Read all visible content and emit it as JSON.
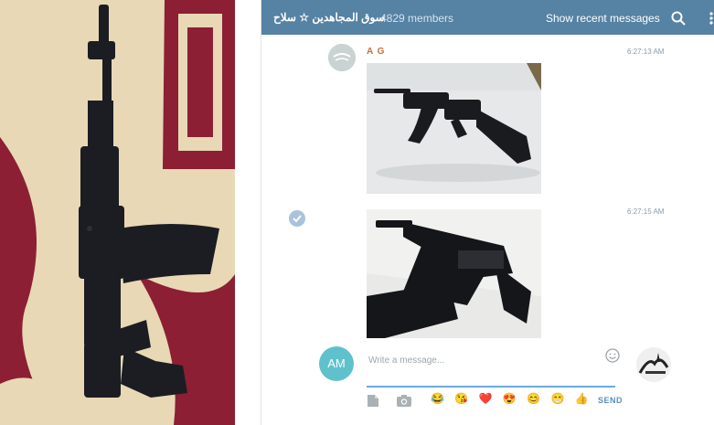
{
  "header": {
    "title": "سوق المجاهدين ☆ سلاح",
    "members": "4829 members",
    "show_recent": "Show recent messages"
  },
  "messages": [
    {
      "author": "A G",
      "time": "6:27:13 AM"
    },
    {
      "time": "6:27:15 AM"
    }
  ],
  "compose": {
    "avatar_initials": "AM",
    "placeholder": "Write a message...",
    "send_label": "SEND"
  },
  "emoji_bar": [
    "😂",
    "😘",
    "❤️",
    "😍",
    "😊",
    "😁",
    "👍"
  ],
  "colors": {
    "header": "#5682a3",
    "accent": "#5fc1cc",
    "author": "#c5703d"
  }
}
